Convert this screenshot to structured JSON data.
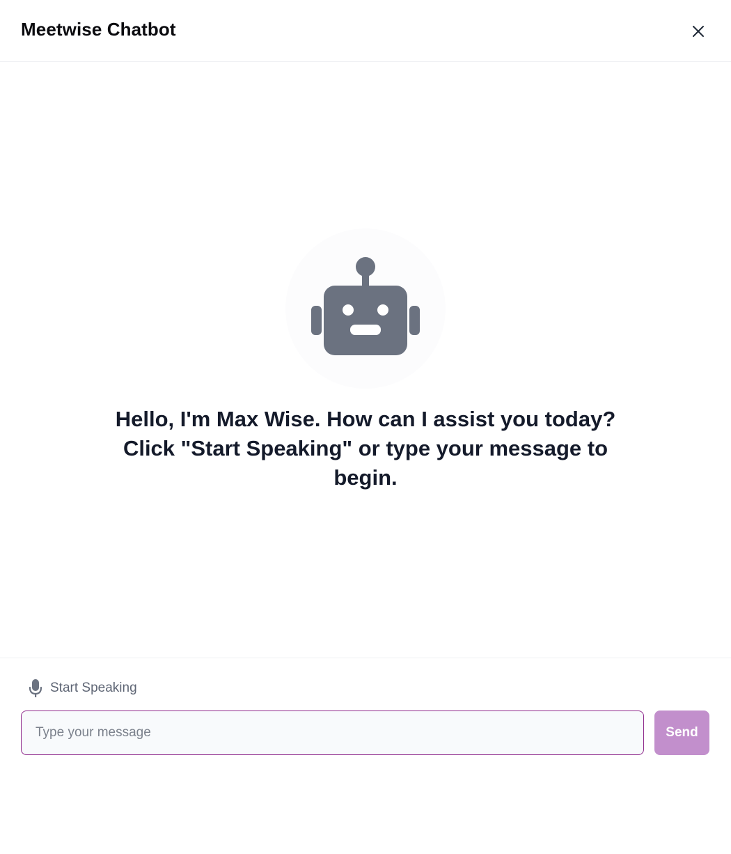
{
  "header": {
    "title": "Meetwise Chatbot",
    "close_icon": "close-icon"
  },
  "main": {
    "avatar_icon": "robot-icon",
    "greeting": "Hello, I'm Max Wise. How can I assist you today? Click \"Start Speaking\" or type your message to begin."
  },
  "footer": {
    "speak_icon": "microphone-icon",
    "speak_label": "Start Speaking",
    "input_value": "",
    "input_placeholder": "Type your message",
    "send_label": "Send"
  },
  "colors": {
    "input_border": "#8f2a8c",
    "send_button": "#c28fcc",
    "robot_icon": "#6b7280",
    "greeting_text": "#141a2a"
  }
}
